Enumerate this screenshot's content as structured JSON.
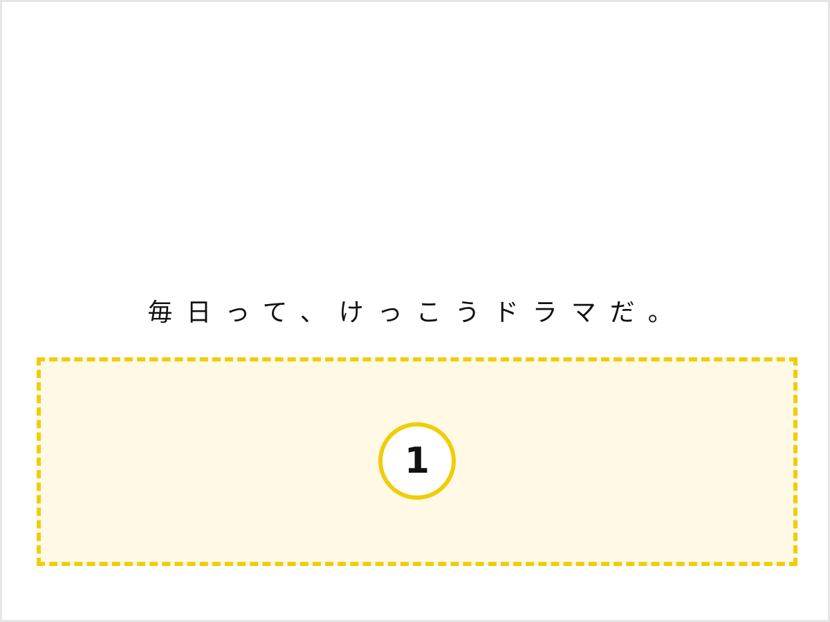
{
  "headline": "毎日って、けっこうドラマだ。",
  "badge": {
    "number": "1"
  },
  "colors": {
    "accent": "#f0cd0a",
    "drop_area_fill": "#fff9e6",
    "frame_border": "#e6e6e6",
    "text": "#111111"
  }
}
